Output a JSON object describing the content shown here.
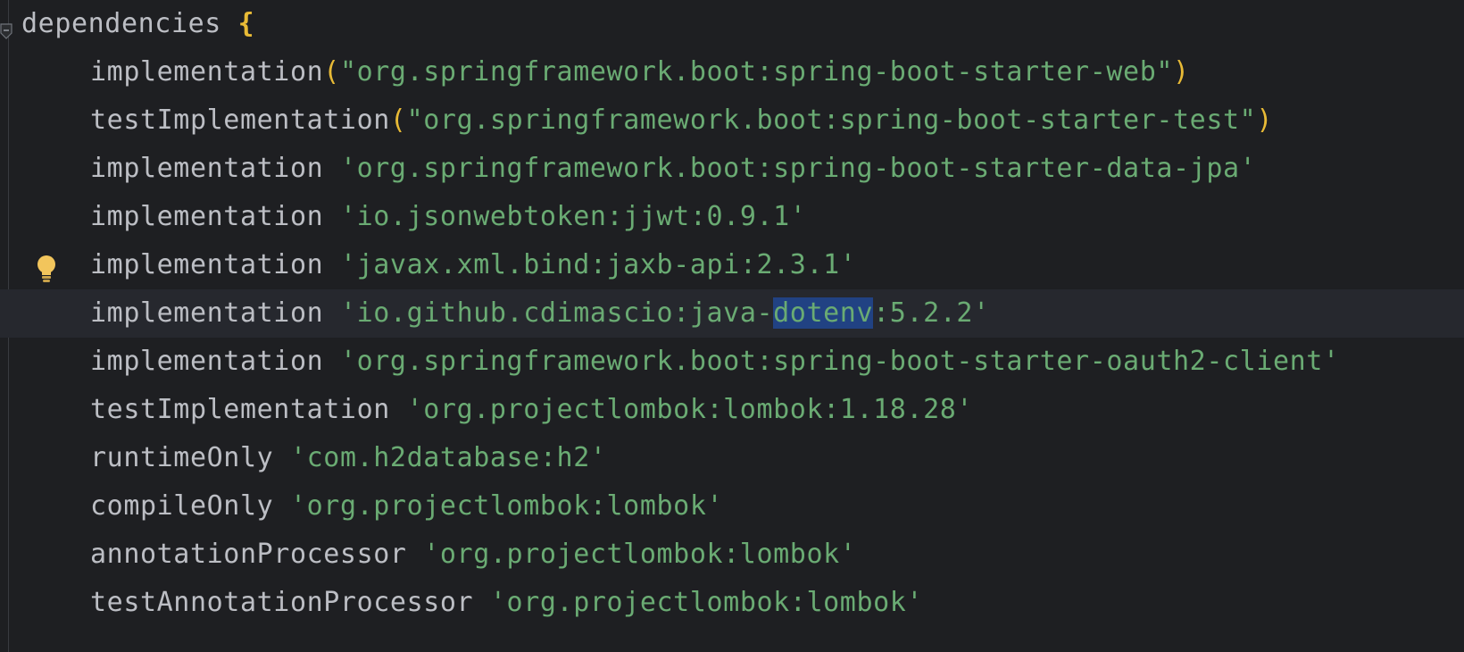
{
  "editor": {
    "lines": [
      {
        "head": "dependencies",
        "open_brace": "{"
      },
      {
        "fn": "implementation",
        "open": "(",
        "arg": "\"org.springframework.boot:spring-boot-starter-web\"",
        "close": ")"
      },
      {
        "fn": "testImplementation",
        "open": "(",
        "arg": "\"org.springframework.boot:spring-boot-starter-test\"",
        "close": ")"
      },
      {
        "fn": "implementation ",
        "arg": "'org.springframework.boot:spring-boot-starter-data-jpa'"
      },
      {
        "fn": "implementation ",
        "arg": "'io.jsonwebtoken:jjwt:0.9.1'"
      },
      {
        "fn": "implementation ",
        "arg": "'javax.xml.bind:jaxb-api:2.3.1'"
      },
      {
        "fn": "implementation ",
        "arg_pre": "'io.github.cdimascio:java-",
        "selected": "dotenv",
        "arg_post": ":5.2.2'"
      },
      {
        "fn": "implementation ",
        "arg": "'org.springframework.boot:spring-boot-starter-oauth2-client'"
      },
      {
        "fn": "testImplementation ",
        "arg": "'org.projectlombok:lombok:1.18.28'"
      },
      {
        "fn": "runtimeOnly ",
        "arg": "'com.h2database:h2'"
      },
      {
        "fn": "compileOnly ",
        "arg": "'org.projectlombok:lombok'"
      },
      {
        "fn": "annotationProcessor ",
        "arg": "'org.projectlombok:lombok'"
      },
      {
        "fn": "testAnnotationProcessor ",
        "arg": "'org.projectlombok:lombok'"
      }
    ],
    "gutter_icons": {
      "fold": "fold-marker-icon",
      "intention": "lightbulb-icon"
    },
    "colors": {
      "background": "#1e1f22",
      "text": "#bcbec4",
      "string": "#6aab73",
      "bracket": "#e8ba36",
      "selection": "#214283",
      "current_line": "#26282e"
    }
  }
}
